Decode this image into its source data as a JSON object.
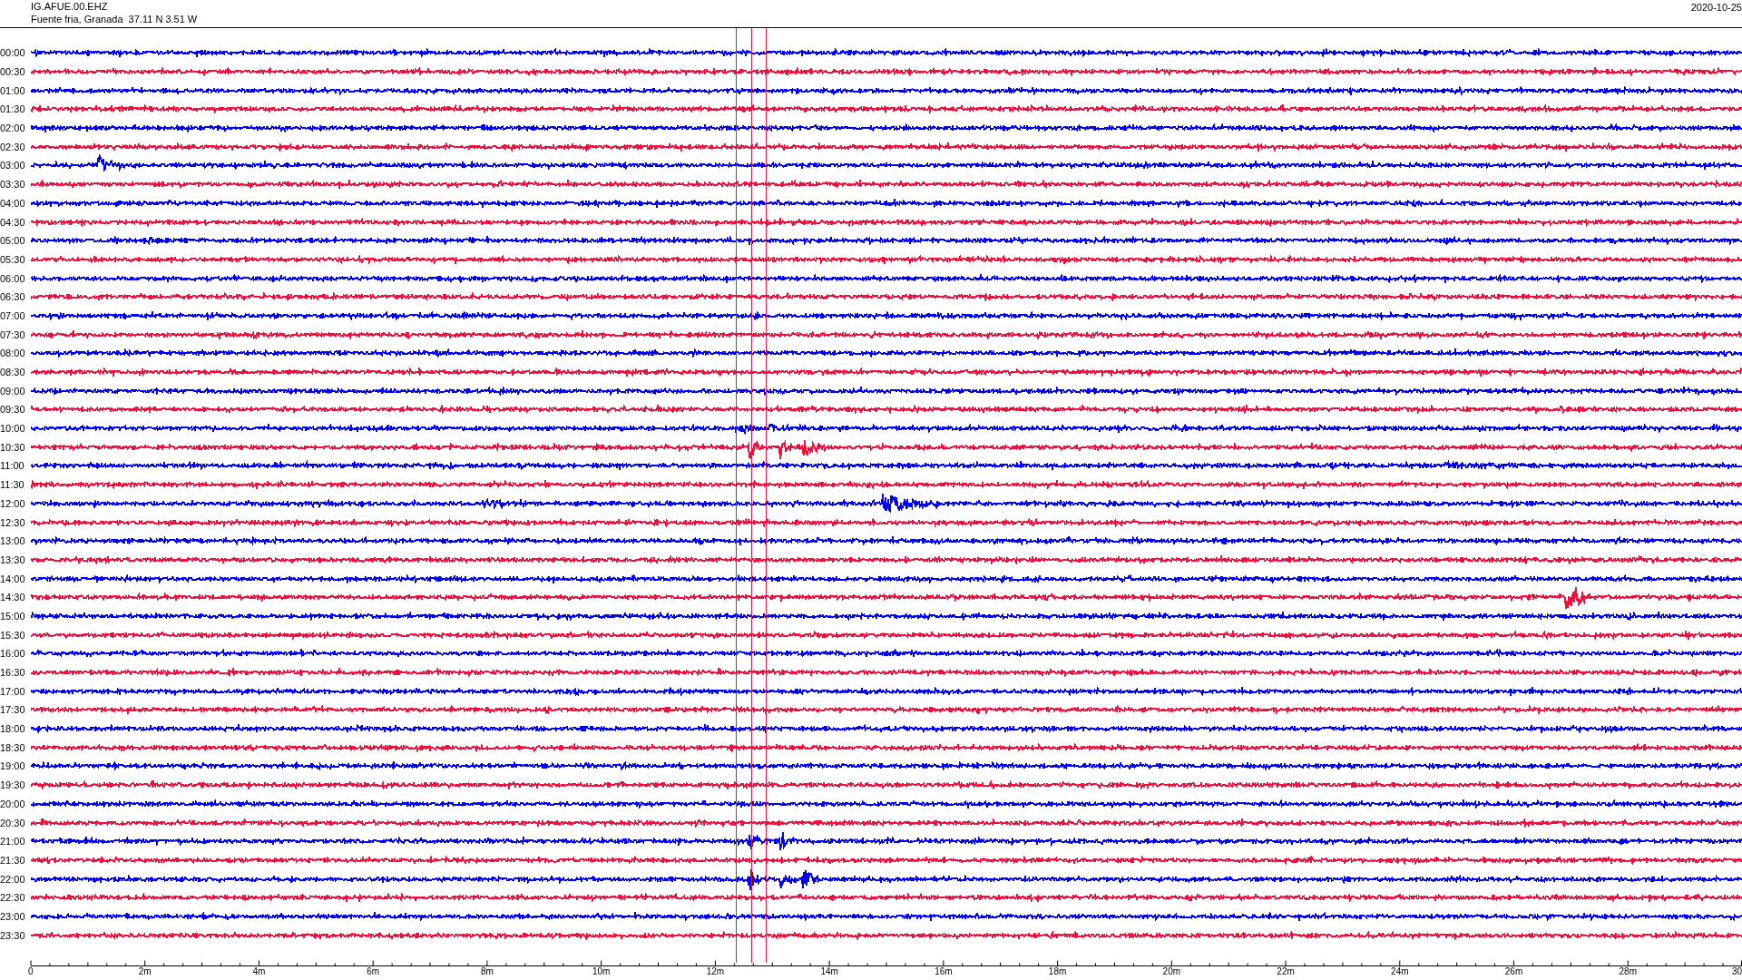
{
  "header": {
    "station": "IG.AFUE.00.EHZ",
    "location": "Fuente fria, Granada  37.11 N 3.51 W",
    "date": "2020-10-25"
  },
  "rows": [
    {
      "time": "00:00",
      "color": "#0000ff"
    },
    {
      "time": "00:30",
      "color": "#f0103c"
    },
    {
      "time": "01:00",
      "color": "#0000ff"
    },
    {
      "time": "01:30",
      "color": "#f0103c"
    },
    {
      "time": "02:00",
      "color": "#0000ff"
    },
    {
      "time": "02:30",
      "color": "#f0103c"
    },
    {
      "time": "03:00",
      "color": "#0000ff"
    },
    {
      "time": "03:30",
      "color": "#f0103c"
    },
    {
      "time": "04:00",
      "color": "#0000ff"
    },
    {
      "time": "04:30",
      "color": "#f0103c"
    },
    {
      "time": "05:00",
      "color": "#0000ff"
    },
    {
      "time": "05:30",
      "color": "#f0103c"
    },
    {
      "time": "06:00",
      "color": "#0000ff"
    },
    {
      "time": "06:30",
      "color": "#f0103c"
    },
    {
      "time": "07:00",
      "color": "#0000ff"
    },
    {
      "time": "07:30",
      "color": "#f0103c"
    },
    {
      "time": "08:00",
      "color": "#0000ff"
    },
    {
      "time": "08:30",
      "color": "#f0103c"
    },
    {
      "time": "09:00",
      "color": "#0000ff"
    },
    {
      "time": "09:30",
      "color": "#f0103c"
    },
    {
      "time": "10:00",
      "color": "#0000ff"
    },
    {
      "time": "10:30",
      "color": "#f0103c"
    },
    {
      "time": "11:00",
      "color": "#0000ff"
    },
    {
      "time": "11:30",
      "color": "#f0103c"
    },
    {
      "time": "12:00",
      "color": "#0000ff"
    },
    {
      "time": "12:30",
      "color": "#f0103c"
    },
    {
      "time": "13:00",
      "color": "#0000ff"
    },
    {
      "time": "13:30",
      "color": "#f0103c"
    },
    {
      "time": "14:00",
      "color": "#0000ff"
    },
    {
      "time": "14:30",
      "color": "#f0103c"
    },
    {
      "time": "15:00",
      "color": "#0000ff"
    },
    {
      "time": "15:30",
      "color": "#f0103c"
    },
    {
      "time": "16:00",
      "color": "#0000ff"
    },
    {
      "time": "16:30",
      "color": "#f0103c"
    },
    {
      "time": "17:00",
      "color": "#0000ff"
    },
    {
      "time": "17:30",
      "color": "#f0103c"
    },
    {
      "time": "18:00",
      "color": "#0000ff"
    },
    {
      "time": "18:30",
      "color": "#f0103c"
    },
    {
      "time": "19:00",
      "color": "#0000ff"
    },
    {
      "time": "19:30",
      "color": "#f0103c"
    },
    {
      "time": "20:00",
      "color": "#0000ff"
    },
    {
      "time": "20:30",
      "color": "#f0103c"
    },
    {
      "time": "21:00",
      "color": "#0000ff"
    },
    {
      "time": "21:30",
      "color": "#f0103c"
    },
    {
      "time": "22:00",
      "color": "#0000ff"
    },
    {
      "time": "22:30",
      "color": "#f0103c"
    },
    {
      "time": "23:00",
      "color": "#0000ff"
    },
    {
      "time": "23:30",
      "color": "#f0103c"
    }
  ],
  "axis_labels": [
    "0",
    "2m",
    "4m",
    "6m",
    "8m",
    "10m",
    "12m",
    "14m",
    "16m",
    "18m",
    "20m",
    "22m",
    "24m",
    "26m",
    "28m",
    "30"
  ]
}
